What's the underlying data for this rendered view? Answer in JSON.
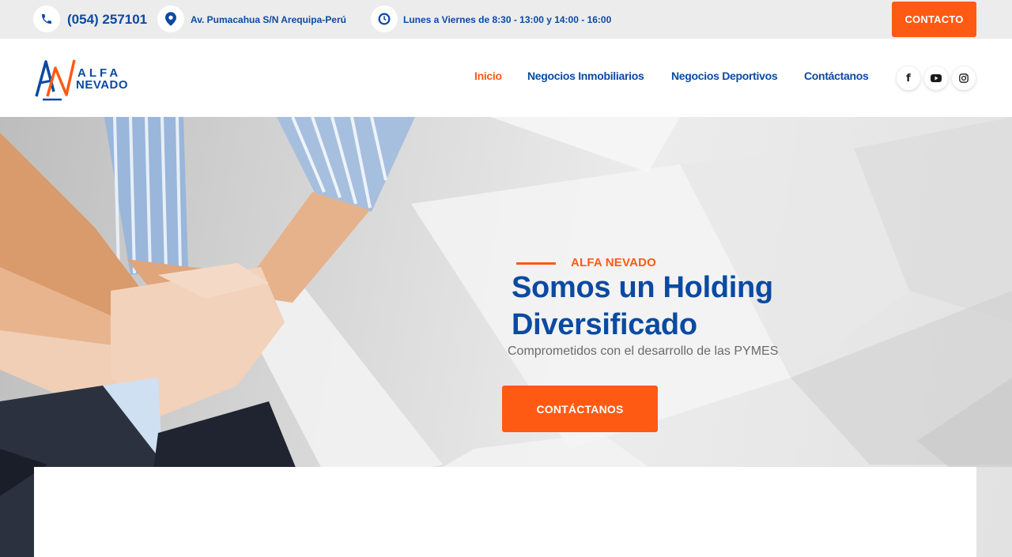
{
  "topbar": {
    "phone": "(054) 257101",
    "address": "Av. Pumacahua S/N Arequipa-Perú",
    "hours": "Lunes a Viernes de 8:30 - 13:00 y 14:00 - 16:00",
    "contact_button": "CONTACTO",
    "icons": [
      "phone-icon",
      "location-pin-icon",
      "clock-icon"
    ]
  },
  "header": {
    "logo": {
      "monogram": "AN",
      "word1": "ALFA",
      "word2": "NEVADO"
    },
    "nav": [
      {
        "label": "Inicio",
        "active": true
      },
      {
        "label": "Negocios Inmobiliarios",
        "active": false
      },
      {
        "label": "Negocios Deportivos",
        "active": false
      },
      {
        "label": "Contáctanos",
        "active": false
      }
    ],
    "social": [
      {
        "name": "facebook-icon",
        "glyph": "f"
      },
      {
        "name": "youtube-icon",
        "glyph": "▶"
      },
      {
        "name": "instagram-icon",
        "glyph": "◎"
      }
    ]
  },
  "hero": {
    "eyebrow": "ALFA NEVADO",
    "title_line1": "Somos un Holding",
    "title_line2": "Diversificado",
    "subtitle": "Comprometidos con el desarrollo de las PYMES",
    "button": "CONTÁCTANOS"
  },
  "colors": {
    "accent": "#ff5a14",
    "brand": "#0b4aa2",
    "topbar_bg": "#ececec"
  }
}
